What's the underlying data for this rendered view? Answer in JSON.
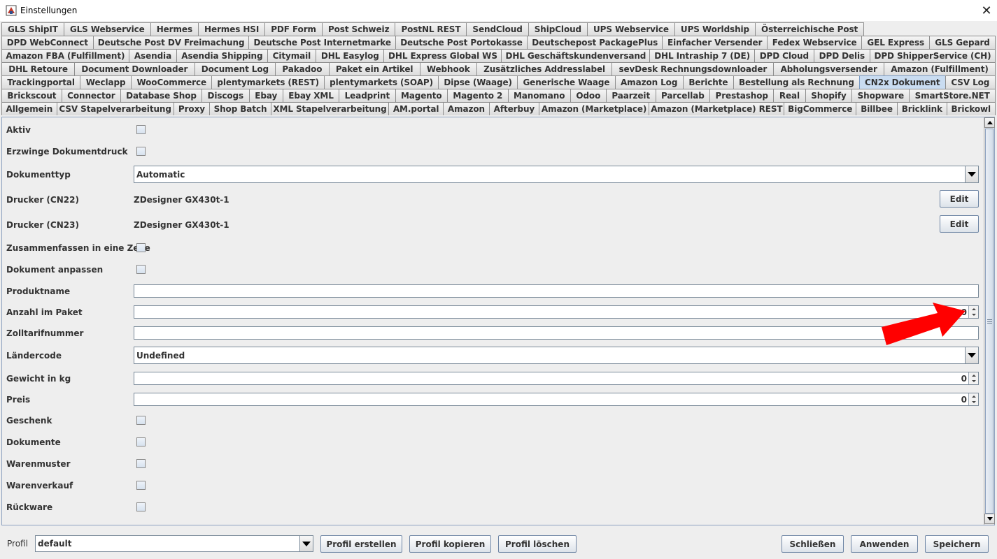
{
  "window": {
    "title": "Einstellungen",
    "close_symbol": "✕"
  },
  "tabs": {
    "rows": [
      [
        "GLS ShipIT",
        "GLS Webservice",
        "Hermes",
        "Hermes HSI",
        "PDF Form",
        "Post Schweiz",
        "PostNL REST",
        "SendCloud",
        "ShipCloud",
        "UPS Webservice",
        "UPS Worldship",
        "Österreichische Post"
      ],
      [
        "DPD WebConnect",
        "Deutsche Post DV Freimachung",
        "Deutsche Post Internetmarke",
        "Deutsche Post Portokasse",
        "Deutschepost PackagePlus",
        "Einfacher Versender",
        "Fedex Webservice",
        "GEL Express",
        "GLS Gepard"
      ],
      [
        "Amazon FBA (Fulfillment)",
        "Asendia",
        "Asendia Shipping",
        "Citymail",
        "DHL Easylog",
        "DHL Express Global WS",
        "DHL Geschäftskundenversand",
        "DHL Intraship 7 (DE)",
        "DPD Cloud",
        "DPD Delis",
        "DPD ShipperService (CH)"
      ],
      [
        "DHL Retoure",
        "Document Downloader",
        "Document Log",
        "Pakadoo",
        "Paket ein Artikel",
        "Webhook",
        "Zusätzliches Addresslabel",
        "sevDesk Rechnungsdownloader",
        "Abholungsversender",
        "Amazon (Fulfillment)"
      ],
      [
        "Trackingportal",
        "Weclapp",
        "WooCommerce",
        "plentymarkets (REST)",
        "plentymarkets (SOAP)",
        "Dipse (Waage)",
        "Generische Waage",
        "Amazon Log",
        "Berichte",
        "Bestellung als Rechnung",
        "CN2x Dokument",
        "CSV Log"
      ],
      [
        "Brickscout",
        "Connector",
        "Database Shop",
        "Discogs",
        "Ebay",
        "Ebay XML",
        "Leadprint",
        "Magento",
        "Magento 2",
        "Manomano",
        "Odoo",
        "Paarzeit",
        "Parcellab",
        "Prestashop",
        "Real",
        "Shopify",
        "Shopware",
        "SmartStore.NET"
      ],
      [
        "Allgemein",
        "CSV Stapelverarbeitung",
        "Proxy",
        "Shop Batch",
        "XML Stapelverarbeitung",
        "AM.portal",
        "Amazon",
        "Afterbuy",
        "Amazon (Marketplace)",
        "Amazon (Marketplace) REST",
        "BigCommerce",
        "Billbee",
        "Bricklink",
        "Brickowl"
      ]
    ],
    "selected": "CN2x Dokument"
  },
  "form": {
    "aktiv": {
      "label": "Aktiv",
      "checked": false
    },
    "erzwinge": {
      "label": "Erzwinge Dokumentdruck",
      "checked": false
    },
    "dokumenttyp": {
      "label": "Dokumenttyp",
      "value": "Automatic"
    },
    "drucker_cn22": {
      "label": "Drucker (CN22)",
      "value": "ZDesigner GX430t-1",
      "button": "Edit"
    },
    "drucker_cn23": {
      "label": "Drucker (CN23)",
      "value": "ZDesigner GX430t-1",
      "button": "Edit"
    },
    "zusammenfassen": {
      "label": "Zusammenfassen in eine Zeile",
      "checked": false
    },
    "anpassen": {
      "label": "Dokument anpassen",
      "checked": false
    },
    "produktname": {
      "label": "Produktname",
      "value": ""
    },
    "anzahl": {
      "label": "Anzahl im Paket",
      "value": "0"
    },
    "zolltarif": {
      "label": "Zolltarifnummer",
      "value": ""
    },
    "laendercode": {
      "label": "Ländercode",
      "value": "Undefined"
    },
    "gewicht": {
      "label": "Gewicht in kg",
      "value": "0"
    },
    "preis": {
      "label": "Preis",
      "value": "0"
    },
    "geschenk": {
      "label": "Geschenk",
      "checked": false
    },
    "dokumente": {
      "label": "Dokumente",
      "checked": false
    },
    "warenmuster": {
      "label": "Warenmuster",
      "checked": false
    },
    "warenverkauf": {
      "label": "Warenverkauf",
      "checked": false
    },
    "rueckware": {
      "label": "Rückware",
      "checked": false
    }
  },
  "footer": {
    "profile_label": "Profil",
    "profile_value": "default",
    "create": "Profil erstellen",
    "copy": "Profil kopieren",
    "delete": "Profil löschen",
    "close": "Schließen",
    "apply": "Anwenden",
    "save": "Speichern"
  },
  "colors": {
    "arrow": "#ff0000",
    "selected_tab": "#c9dcf1"
  }
}
